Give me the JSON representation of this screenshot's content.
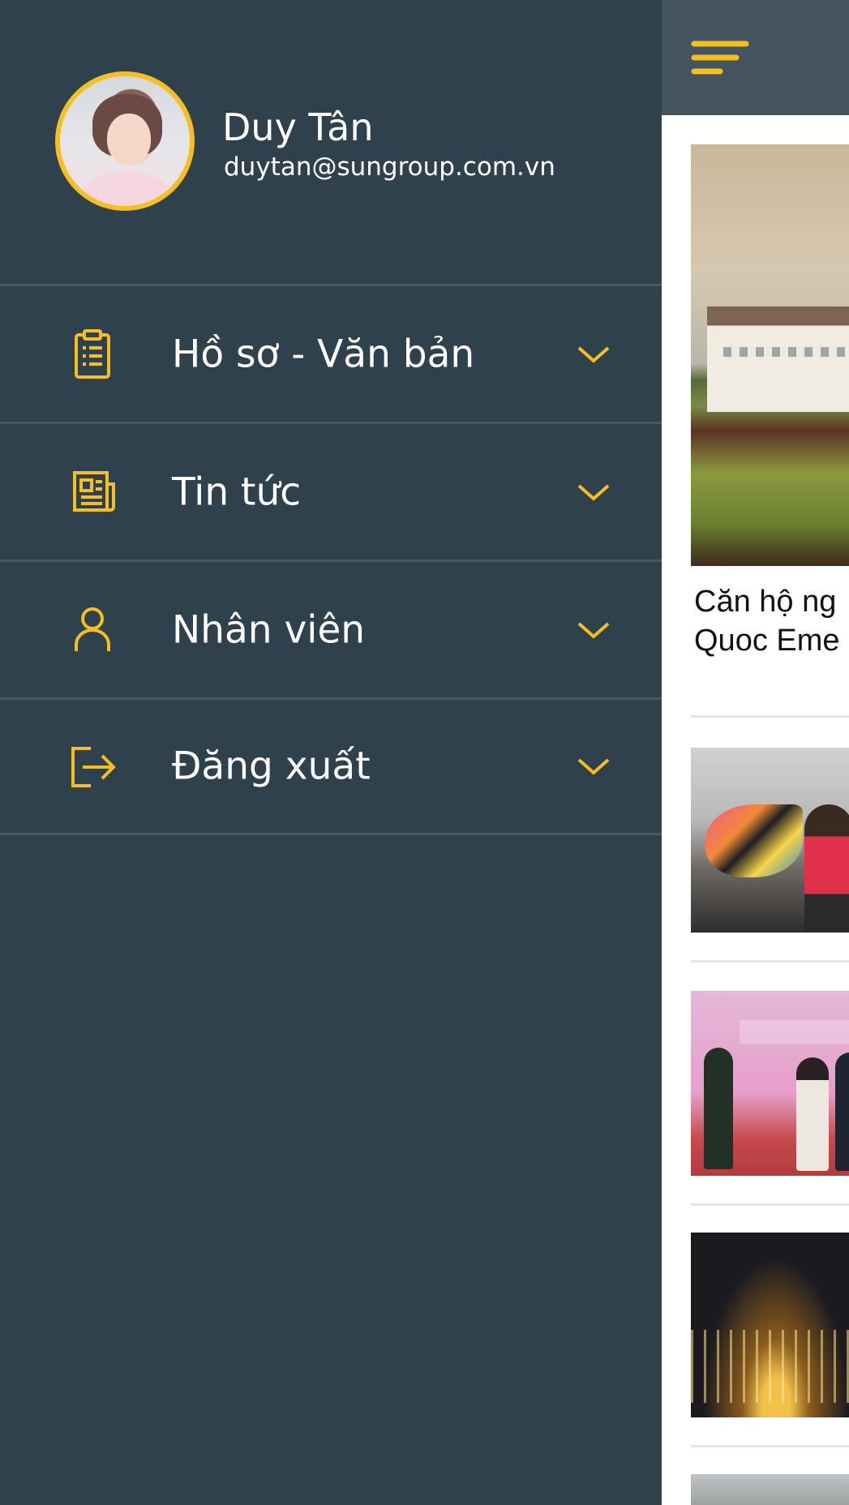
{
  "user": {
    "name": "Duy Tân",
    "email": "duytan@sungroup.com.vn"
  },
  "menu": {
    "items": [
      {
        "label": "Hồ sơ - Văn bản",
        "icon": "clipboard-icon"
      },
      {
        "label": "Tin tức",
        "icon": "newspaper-icon"
      },
      {
        "label": "Nhân viên",
        "icon": "person-icon"
      },
      {
        "label": "Đăng xuất",
        "icon": "logout-icon"
      }
    ]
  },
  "news": {
    "first_title_line1": "Căn hộ ng",
    "first_title_line2": "Quoc Eme"
  },
  "colors": {
    "drawer_background": "#2f414c",
    "accent": "#f5be22",
    "divider": "#465963",
    "header_background": "#445560"
  }
}
